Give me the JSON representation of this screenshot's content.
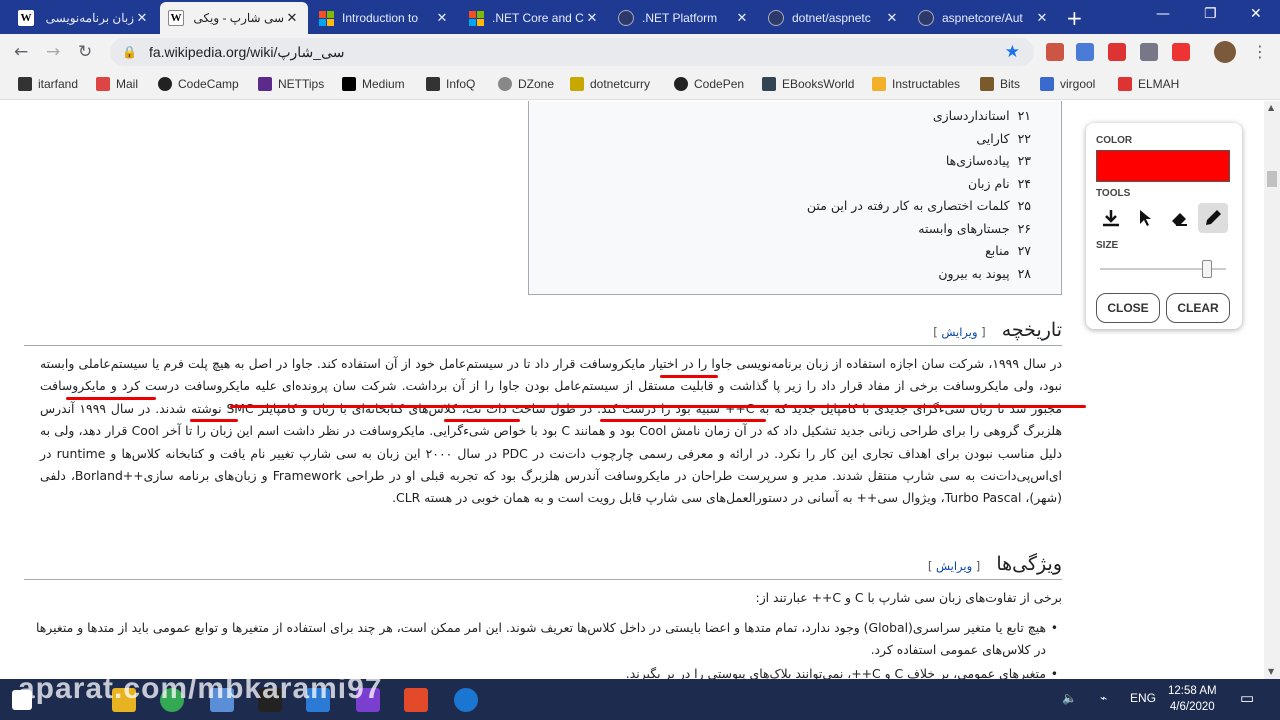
{
  "tabs": [
    {
      "title": "زبان برنامه‌نویسی",
      "icon": "wikipedia-icon",
      "active": false
    },
    {
      "title": "سی شارپ - ویکی",
      "icon": "wikipedia-icon",
      "active": true
    },
    {
      "title": "Introduction to",
      "icon": "microsoft-icon",
      "active": false
    },
    {
      "title": ".NET Core and C",
      "icon": "microsoft-icon",
      "active": false
    },
    {
      "title": ".NET Platform",
      "icon": "github-icon",
      "active": false
    },
    {
      "title": "dotnet/aspnetc",
      "icon": "github-icon",
      "active": false
    },
    {
      "title": "aspnetcore/Aut",
      "icon": "github-icon",
      "active": false
    }
  ],
  "address": {
    "url": "fa.wikipedia.org/wiki/سی_شارپ"
  },
  "bookmarks": [
    "itarfand",
    "Mail",
    "CodeCamp",
    "NETTips",
    "Medium",
    "InfoQ",
    "DZone",
    "dotnetcurry",
    "CodePen",
    "EBooksWorld",
    "Instructables",
    "Bits",
    "virgool",
    "ELMAH"
  ],
  "toc": [
    {
      "num": "۲۱",
      "label": "استانداردسازی"
    },
    {
      "num": "۲۲",
      "label": "کارایی"
    },
    {
      "num": "۲۳",
      "label": "پیاده‌سازی‌ها"
    },
    {
      "num": "۲۴",
      "label": "نام زبان"
    },
    {
      "num": "۲۵",
      "label": "کلمات اختصاری به کار رفته در این متن"
    },
    {
      "num": "۲۶",
      "label": "جستارهای وابسته"
    },
    {
      "num": "۲۷",
      "label": "منابع"
    },
    {
      "num": "۲۸",
      "label": "پیوند به بیرون"
    }
  ],
  "history": {
    "heading": "تاریخچه",
    "edit": "ویرایش",
    "p1": "در سال ۱۹۹۹، شرکت سان اجازه استفاده از زبان برنامه‌نویسی جاوا را در اختیار مایکروسافت قرار داد تا در سیستم‌عامل خود از آن استفاده کند. جاوا در اصل به هیچ پلت فرم یا سیستم‌عاملی وابسته نبود، ولی مایکروسافت برخی از مفاد قرار داد را زیر پا گذاشت و قابلیت مستقل از سیستم‌عامل بودن جاوا را از آن برداشت. شرکت سان پرونده‌ای علیه مایکروسافت درست کرد و مایکروسافت مجبور شد تا زبان شی‌ءگرای جدیدی با کامپایل جدید که به C++ شبیه بود را درست کند. در طول ساخت دات نت، کلاس‌های کتابخانه‌ای با زبان و کامپایلر SMC نوشته شدند. در سال ۱۹۹۹ آندرس هلزبرگ گروهی را برای طراحی زبانی جدید تشکیل داد که در آن زمان نامش Cool بود و همانند C بود با خواص شی‌ءگرایی. مایکروسافت در نظر داشت اسم این زبان را تا آخر Cool قرار دهد، ولی به دلیل مناسب نبودن برای اهداف تجاری این کار را نکرد. در ارائه و معرفی رسمی چارچوب دات‌نت در PDC در سال ۲۰۰۰ این زبان به سی شارپ تغییر نام یافت و کتابخانه کلاس‌ها و runtime در ای‌اس‌پی‌دات‌نت به سی شارپ منتقل شدند. مدیر و سرپرست طراحان در مایکروسافت آندرس هلزبرگ بود که تجربه قبلی او در طراحی Framework و زبان‌های برنامه سازی++Borland، دلفی (شهر)، Turbo Pascal، ویژوال سی++ به آسانی در دستورالعمل‌های سی شارپ قابل رویت است و به همان خوبی در هسته CLR."
  },
  "features": {
    "heading": "ویژگی‌ها",
    "edit": "ویرایش",
    "intro": "برخی از تفاوت‌های زبان سی شارپ با C و C++ عبارتند از:",
    "b1": "هیچ تابع یا متغیر سراسری(Global) وجود ندارد، تمام متدها و اعضا بایستی در داخل کلاس‌ها تعریف شوند. این امر ممکن است، هر چند برای استفاده از متغیرها و توابع عمومی باید از متدها و متغیرها در کلاس‌های عمومی استفاده کرد.",
    "b2": "متغیرهای عمومی، بر خلاف C و C++، نمی‌توانند بلاک‌های پیوستی را در بر بگیرند."
  },
  "tool": {
    "color_label": "COLOR",
    "color": "#ff0000",
    "tools_label": "TOOLS",
    "size_label": "SIZE",
    "size_level": 0.85,
    "close": "CLOSE",
    "clear": "CLEAR"
  },
  "taskbar": {
    "lang": "ENG",
    "time": "12:58 AM",
    "date": "4/6/2020"
  },
  "watermark": "aparat.com/mbkarami97"
}
